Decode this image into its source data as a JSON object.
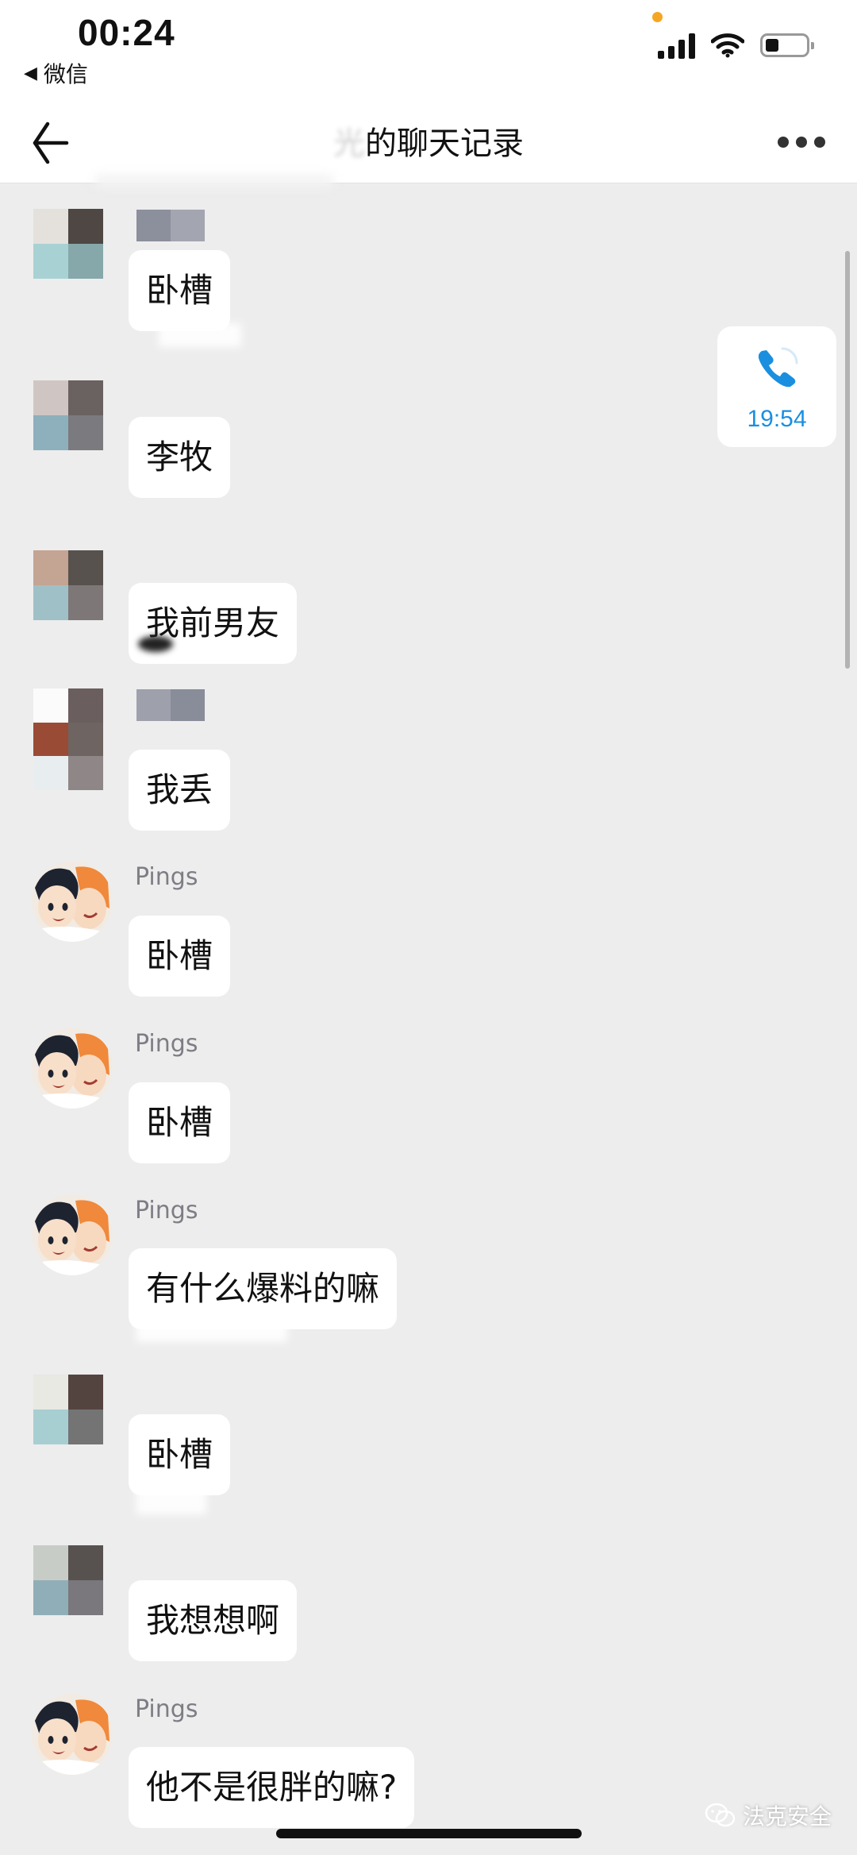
{
  "status_bar": {
    "time": "00:24",
    "back_app_label": "微信",
    "indicator_color": "#f5a623"
  },
  "nav": {
    "title_blurred_prefix": "光",
    "title": "的聊天记录",
    "back_icon": "back-arrow-icon",
    "more_icon": "more-dots-icon"
  },
  "messages": [
    {
      "sender": "",
      "text": "卧槽"
    },
    {
      "sender": "",
      "text": "李牧"
    },
    {
      "sender": "",
      "text": "我前男友"
    },
    {
      "sender": "",
      "text": "我丢"
    },
    {
      "sender": "Pings",
      "text": "卧槽"
    },
    {
      "sender": "Pings",
      "text": "卧槽"
    },
    {
      "sender": "Pings",
      "text": "有什么爆料的嘛"
    },
    {
      "sender": "",
      "text": "卧槽"
    },
    {
      "sender": "",
      "text": "我想想啊"
    },
    {
      "sender": "Pings",
      "text": "他不是很胖的嘛?"
    }
  ],
  "call_card": {
    "time": "19:54",
    "icon": "phone-icon",
    "color": "#1a8fe0"
  },
  "watermark": {
    "text": "法克安全",
    "icon": "wechat-logo-icon"
  }
}
